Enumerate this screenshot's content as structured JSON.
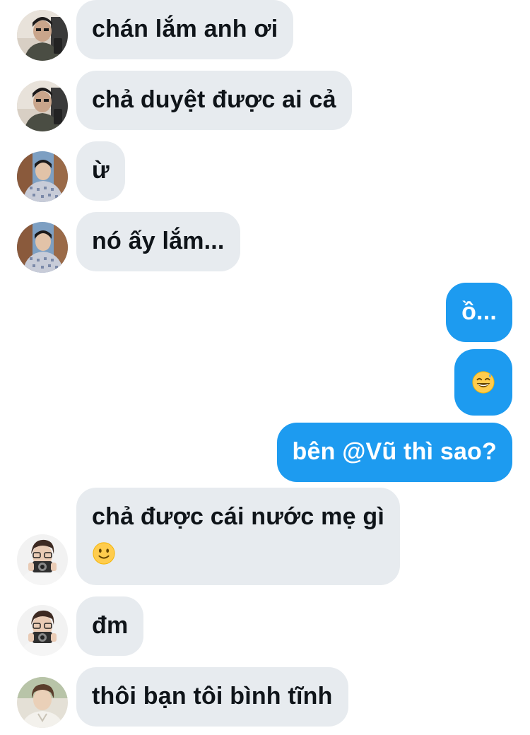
{
  "conversation": {
    "messages": [
      {
        "sender": "incoming",
        "avatar": "avatar-a",
        "text": "chán lắm anh ơi"
      },
      {
        "sender": "incoming",
        "avatar": "avatar-a",
        "text": "chả duyệt được ai cả"
      },
      {
        "sender": "incoming",
        "avatar": "avatar-b",
        "text": "ừ"
      },
      {
        "sender": "incoming",
        "avatar": "avatar-b",
        "text": "nó ấy lắm..."
      },
      {
        "sender": "outgoing",
        "text": "ồ..."
      },
      {
        "sender": "outgoing",
        "emoji": "grinning-sweat-emoji"
      },
      {
        "sender": "outgoing",
        "text": "bên @Vũ thì sao?"
      },
      {
        "sender": "incoming",
        "avatar": "avatar-c",
        "text": "chả được cái nước mẹ gì",
        "emoji": "slight-smile-emoji"
      },
      {
        "sender": "incoming",
        "avatar": "avatar-c",
        "text": "đm"
      },
      {
        "sender": "incoming",
        "avatar": "avatar-d",
        "text": "thôi bạn tôi bình tĩnh"
      }
    ]
  },
  "colors": {
    "incoming_bubble": "#e7ebef",
    "incoming_text": "#0f1419",
    "outgoing_bubble": "#1d9bf0",
    "outgoing_text": "#ffffff",
    "background": "#ffffff"
  }
}
